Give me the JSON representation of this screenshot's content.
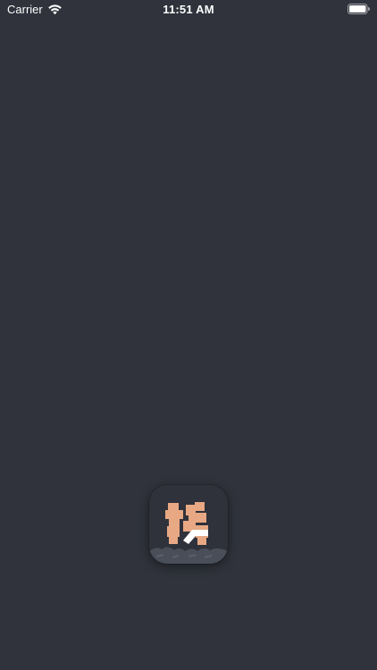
{
  "status_bar": {
    "carrier": "Carrier",
    "time": "11:51 AM",
    "wifi_icon": "wifi-icon",
    "battery_icon": "battery-icon"
  },
  "splash": {
    "icon": "app-icon",
    "colors": {
      "background": "#30333c",
      "icon_background": "#2f323b",
      "figure": "#e7a883",
      "accent": "#ffffff",
      "ground": "#4a4e58"
    }
  }
}
